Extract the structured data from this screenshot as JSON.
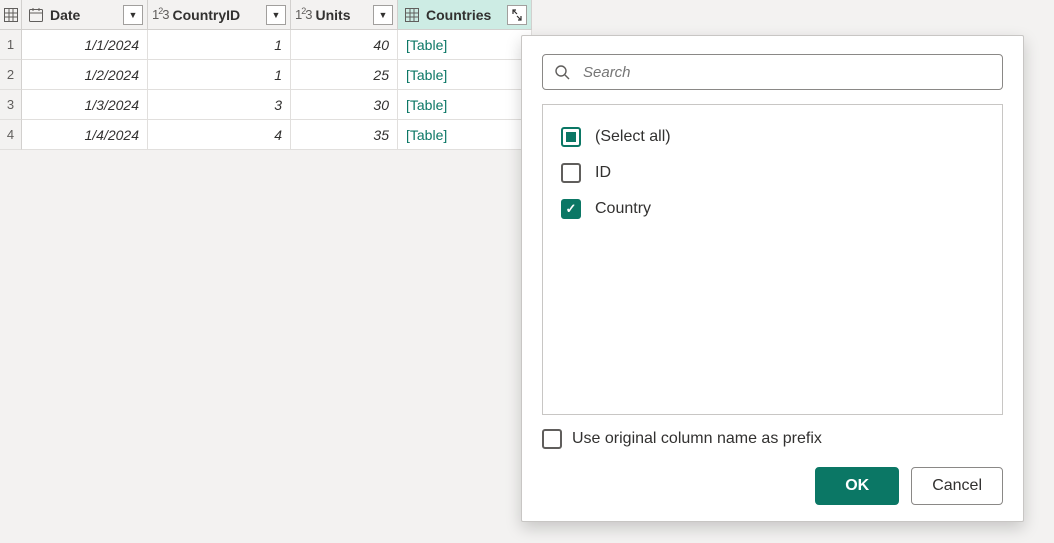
{
  "columns": {
    "date": {
      "label": "Date",
      "type": "date"
    },
    "cid": {
      "label": "CountryID",
      "type": "number"
    },
    "units": {
      "label": "Units",
      "type": "number"
    },
    "countries": {
      "label": "Countries",
      "type": "table",
      "selected": true
    }
  },
  "rows": [
    {
      "n": "1",
      "date": "1/1/2024",
      "cid": "1",
      "units": "40",
      "countries": "[Table]"
    },
    {
      "n": "2",
      "date": "1/2/2024",
      "cid": "1",
      "units": "25",
      "countries": "[Table]"
    },
    {
      "n": "3",
      "date": "1/3/2024",
      "cid": "3",
      "units": "30",
      "countries": "[Table]"
    },
    {
      "n": "4",
      "date": "1/4/2024",
      "cid": "4",
      "units": "35",
      "countries": "[Table]"
    }
  ],
  "popup": {
    "search_placeholder": "Search",
    "options": [
      {
        "label": "(Select all)",
        "state": "indeterminate"
      },
      {
        "label": "ID",
        "state": "unchecked"
      },
      {
        "label": "Country",
        "state": "checked"
      }
    ],
    "prefix_label": "Use original column name as prefix",
    "ok_label": "OK",
    "cancel_label": "Cancel"
  }
}
